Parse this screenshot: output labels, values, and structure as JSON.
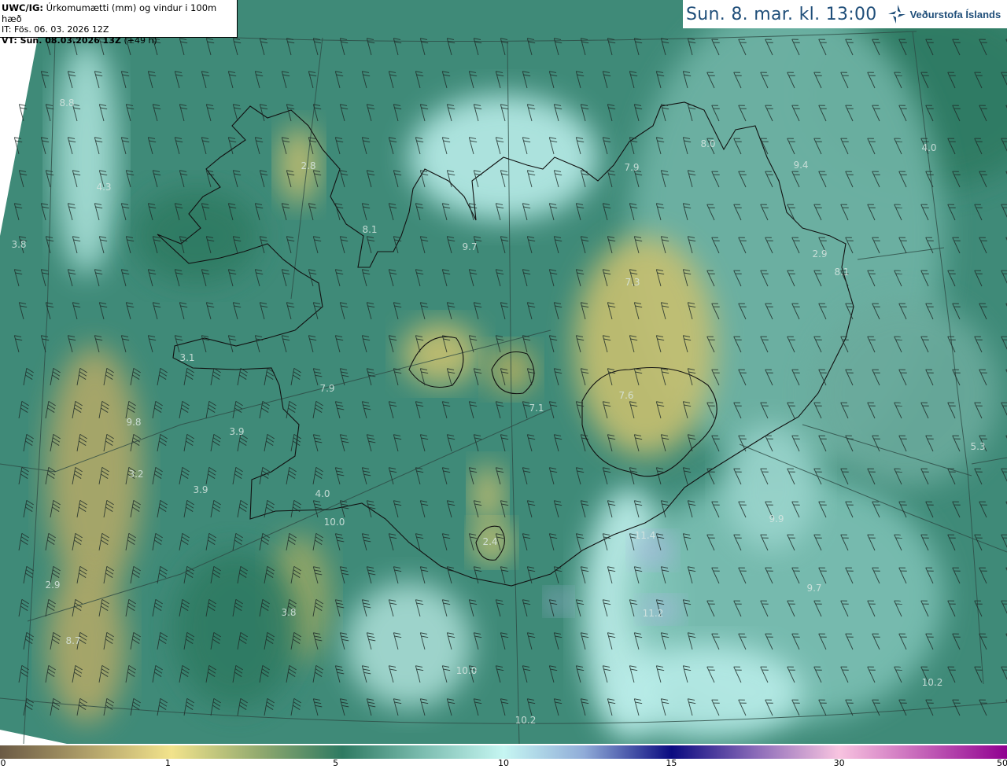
{
  "header": {
    "product_code": "UWC/IG:",
    "product_desc": "Úrkomumætti (mm) og vindur i 100m hæð",
    "initial_time": "IT: Fös. 06. 03. 2026 12Z",
    "valid_time": "VT: Sun. 08.03.2026 13Z",
    "lead_time": "(+49 h)"
  },
  "title": {
    "datetime": "Sun. 8. mar. kl. 13:00",
    "brand": "Veðurstofa Íslands",
    "brand_color": "#1f4e79"
  },
  "map": {
    "labels": [
      "8.8",
      "4.3",
      "3.8",
      "2.8",
      "8.1",
      "3.1",
      "7.9",
      "9.8",
      "3.9",
      "3.2",
      "3.9",
      "4.0",
      "10.0",
      "2.4",
      "2.9",
      "3.8",
      "8.7",
      "9.7",
      "8.0",
      "7.9",
      "9.4",
      "4.0",
      "2.9",
      "8.1",
      "7.3",
      "7.1",
      "7.6",
      "5.3",
      "9.9",
      "11.4",
      "9.7",
      "10.2",
      "10.2",
      "10.0",
      "11.2"
    ],
    "colors": {
      "dry": "#6b5a45",
      "low": "#f2e38c",
      "mid": "#2e7a62",
      "high": "#c6f6f2",
      "heavy": "#0a0a80",
      "extreme": "#900090"
    }
  },
  "colorbar": {
    "ticks": [
      "0",
      "1",
      "5",
      "10",
      "15",
      "30",
      "50"
    ],
    "unit": "mm"
  }
}
